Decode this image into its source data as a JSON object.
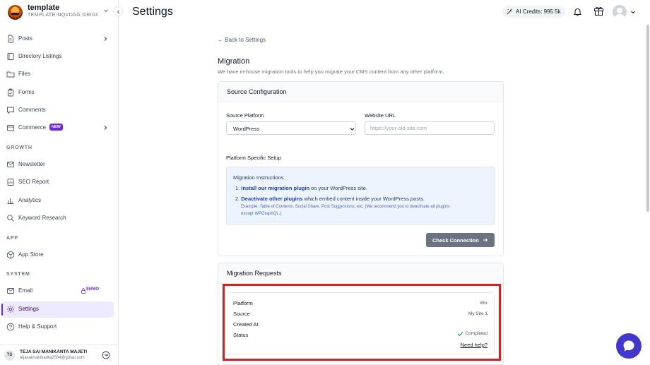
{
  "sidebar": {
    "brand": {
      "name": "template",
      "subtitle": "TEMPLATE-NQVDAG.GRIGOR..."
    },
    "items": [
      {
        "label": "Posts"
      },
      {
        "label": "Directory Listings"
      },
      {
        "label": "Files"
      },
      {
        "label": "Forms"
      },
      {
        "label": "Comments"
      },
      {
        "label": "Commerce",
        "badge": "NEW"
      },
      {
        "label": "Newsletter"
      },
      {
        "label": "SEO Report"
      },
      {
        "label": "Analytics"
      },
      {
        "label": "Keyword Research"
      },
      {
        "label": "App Store"
      },
      {
        "label": "Email",
        "badge": "$5/MO"
      },
      {
        "label": "Settings"
      },
      {
        "label": "Help & Support"
      }
    ],
    "sections": {
      "growth": "GROWTH",
      "app": "APP",
      "system": "SYSTEM"
    },
    "user": {
      "initials": "TS",
      "name": "TEJA SAI MANIKANTA MAJETI",
      "email": "tejasaimanikanta2004@gmail.com"
    }
  },
  "header": {
    "title": "Settings",
    "credits": "AI Credits: 995.5k"
  },
  "main": {
    "back_link": "Back to Settings",
    "title": "Migration",
    "description": "We have in-house migration tools to help you migrate your CMS content from any other platform.",
    "source_config": {
      "heading": "Source Configuration",
      "platform_label": "Source Platform",
      "platform_value": "WordPress",
      "url_label": "Website URL",
      "url_placeholder": "https://your-old-site.com",
      "setup_label": "Platform Specific Setup",
      "instructions": {
        "title": "Migration Instructions",
        "step1_num": "1.",
        "step1_link": "Install our migration plugin",
        "step1_rest": " on your WordPress site.",
        "step2_num": "2.",
        "step2_link": "Deactivate other plugins",
        "step2_rest": " which embed content inside your WordPress posts.",
        "step2_note1": "Example: Table of Contents, Social Share, Post Suggestions, etc. (We recommend you to deactivate all plugins",
        "step2_note2": "except WPGraphQL.)"
      },
      "check_button": "Check Connection"
    },
    "requests": {
      "heading": "Migration Requests",
      "labels": {
        "platform": "Platform",
        "source": "Source",
        "created_at": "Created At",
        "status": "Status"
      },
      "item": {
        "platform": "Wix",
        "source": "My Site 1",
        "created_at": "",
        "status": "Completed"
      },
      "help_link": "Need help?"
    }
  },
  "colors": {
    "accent": "#6d28d9",
    "highlight": "#dc1e1e",
    "chat": "#4338ca",
    "success": "#16a34a"
  }
}
